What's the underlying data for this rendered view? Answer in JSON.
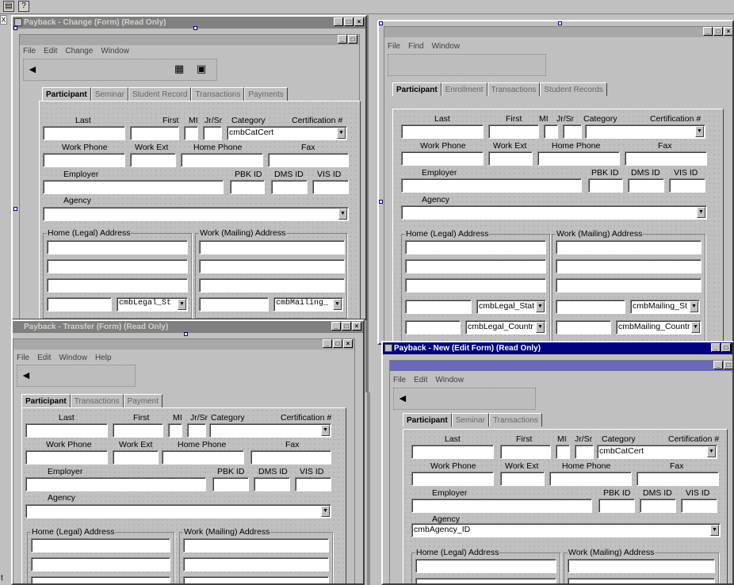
{
  "top_icons": [
    "form-icon",
    "help-icon"
  ],
  "top_help_glyph": "?",
  "window_buttons": {
    "min": "_",
    "max": "□",
    "close": "×"
  },
  "combo_arrow": "▼",
  "side_letter_x": "X",
  "side_letter_t": "t",
  "windows": {
    "w1": {
      "title": "Payback - Change (Form) (Read Only)",
      "menu": [
        "File",
        "Edit",
        "Change",
        "Window"
      ],
      "tabs": [
        "Participant",
        "Seminar",
        "Student Record",
        "Transactions",
        "Payments"
      ],
      "fields": {
        "certification": "cmbCatCert",
        "legal_state": "cmbLegal_St",
        "mailing_state": "cmbMailing_"
      }
    },
    "w2": {
      "title": "",
      "menu": [
        "File",
        "Find",
        "Window"
      ],
      "tabs": [
        "Participant",
        "Enrollment",
        "Transactions",
        "Student Records"
      ],
      "fields": {
        "certification": "",
        "legal_state": "cmbLegal_Stat",
        "mailing_state": "cmbMailing_St",
        "legal_country": "cmbLegal_Countr",
        "mailing_country": "cmbMailing_Countr"
      }
    },
    "w3": {
      "title": "Payback - Transfer (Form) (Read Only)",
      "menu": [
        "File",
        "Edit",
        "Window",
        "Help"
      ],
      "tabs": [
        "Participant",
        "Transactions",
        "Payment"
      ],
      "fields": {
        "certification": ""
      }
    },
    "w4": {
      "title": "Payback - New (Edit Form) (Read Only)",
      "menu": [
        "File",
        "Edit",
        "Window"
      ],
      "tabs": [
        "Participant",
        "Seminar",
        "Transactions"
      ],
      "fields": {
        "certification": "cmbCatCert",
        "agency": "cmbAgency_ID"
      }
    }
  },
  "labels": {
    "last": "Last",
    "first": "First",
    "mi": "MI",
    "jrsr": "Jr/Sr",
    "category": "Category",
    "certification": "Certification #",
    "work_phone": "Work Phone",
    "work_ext": "Work Ext",
    "home_phone": "Home Phone",
    "fax": "Fax",
    "employer": "Employer",
    "pbk_id": "PBK ID",
    "dms_id": "DMS ID",
    "vis_id": "VIS ID",
    "agency": "Agency",
    "home_address": "Home (Legal) Address",
    "work_address": "Work (Mailing) Address"
  }
}
